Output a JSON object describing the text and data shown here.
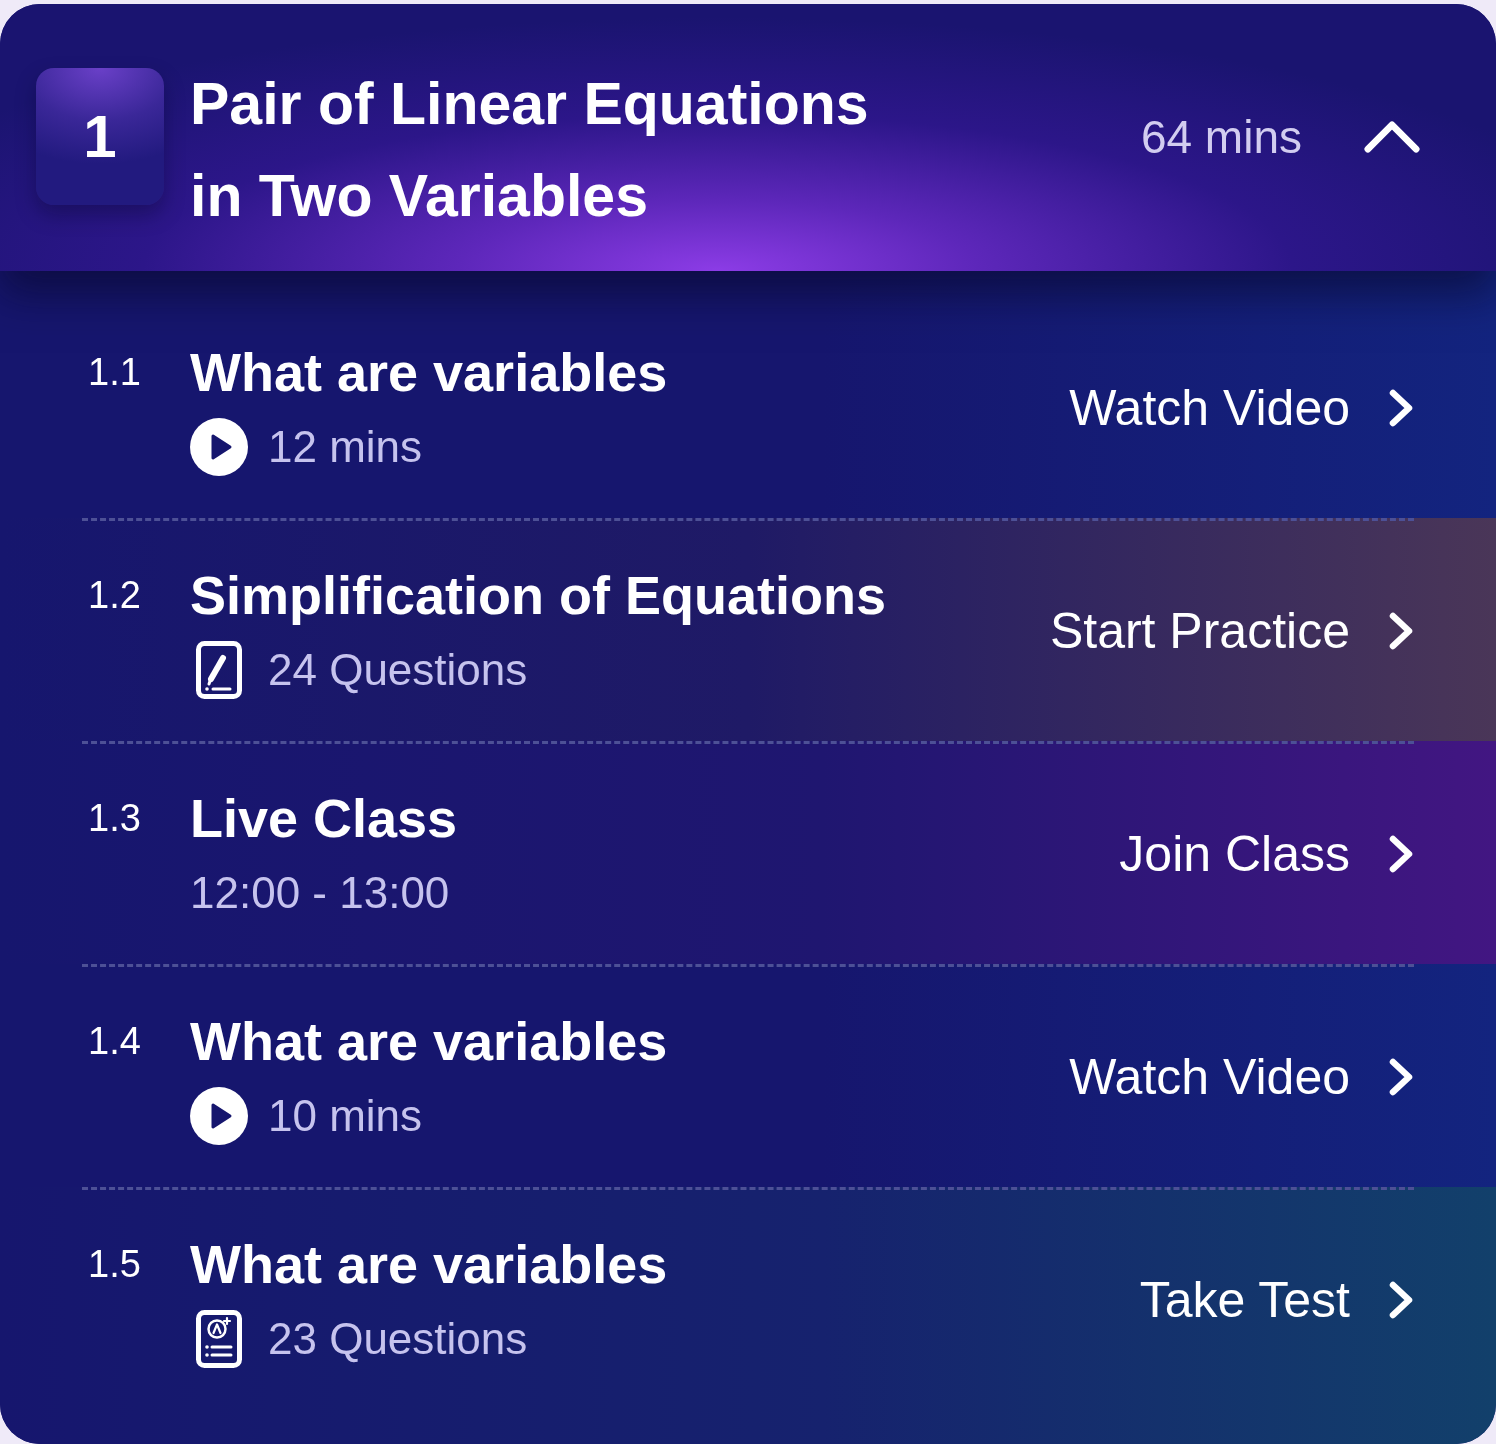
{
  "section": {
    "number": "1",
    "title": "Pair of Linear Equations in Two Variables",
    "duration": "64 mins",
    "expanded": true
  },
  "lessons": [
    {
      "number": "1.1",
      "title": "What are variables",
      "kind": "video",
      "meta": "12 mins",
      "action": "Watch Video"
    },
    {
      "number": "1.2",
      "title": "Simplification of Equations",
      "kind": "practice",
      "meta": "24 Questions",
      "action": "Start Practice"
    },
    {
      "number": "1.3",
      "title": "Live Class",
      "kind": "live",
      "meta": "12:00 - 13:00",
      "action": "Join Class"
    },
    {
      "number": "1.4",
      "title": "What are variables",
      "kind": "video",
      "meta": "10 mins",
      "action": "Watch Video"
    },
    {
      "number": "1.5",
      "title": "What are variables",
      "kind": "test",
      "meta": "23 Questions",
      "action": "Take Test"
    }
  ]
}
